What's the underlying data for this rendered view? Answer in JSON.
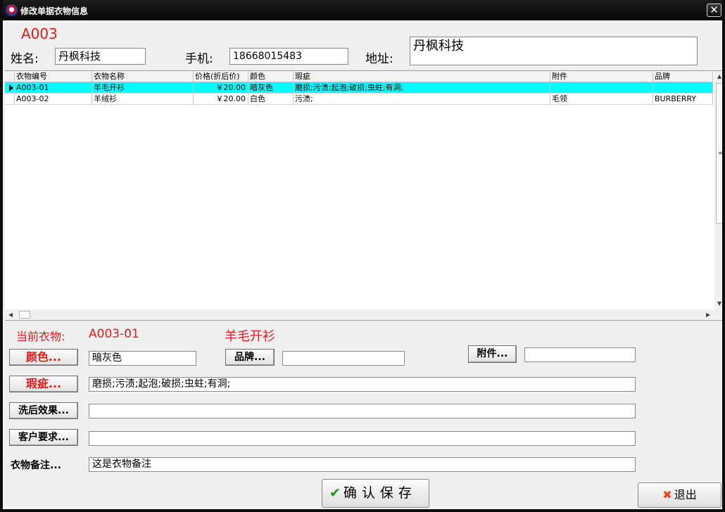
{
  "window": {
    "title": "修改单据衣物信息",
    "close_symbol": "✕"
  },
  "order": {
    "id": "A003",
    "name_label": "姓名:",
    "name_value": "丹枫科技",
    "phone_label": "手机:",
    "phone_value": "18668015483",
    "address_label": "地址:",
    "address_value": "丹枫科技"
  },
  "grid": {
    "columns": [
      "衣物编号",
      "衣物名称",
      "价格(折后价)",
      "颜色",
      "瑕疵",
      "附件",
      "品牌"
    ],
    "rows": [
      {
        "id": "A003-01",
        "name": "羊毛开衫",
        "price": "￥20.00",
        "color": "暗灰色",
        "defects": "磨损;污渍;起泡;破损;虫蛀;有洞;",
        "attachment": "",
        "brand": ""
      },
      {
        "id": "A003-02",
        "name": "羊绒衫",
        "price": "￥20.00",
        "color": "白色",
        "defects": "污渍;",
        "attachment": "毛领",
        "brand": "BURBERRY"
      }
    ],
    "selected_row": 0
  },
  "current": {
    "label": "当前衣物:",
    "id": "A003-01",
    "name": "羊毛开衫"
  },
  "form": {
    "color_button": "颜色...",
    "color_value": "暗灰色",
    "brand_button": "品牌...",
    "brand_value": "",
    "attachment_button": "附件...",
    "attachment_value": "",
    "defects_button": "瑕疵...",
    "defects_value": "磨损;污渍;起泡;破损;虫蛀;有洞;",
    "wash_effect_button": "洗后效果...",
    "wash_effect_value": "",
    "customer_request_button": "客户要求...",
    "customer_request_value": "",
    "notes_label": "衣物备注...",
    "notes_value": "这是衣物备注"
  },
  "actions": {
    "save_icon": "✔",
    "save_label": "确认保存",
    "exit_icon": "✖",
    "exit_label": "退出"
  },
  "icons": {
    "window_icon": "app-logo-icon",
    "close": "close-icon",
    "row_marker": "row-pointer-icon",
    "save": "checkmark-icon",
    "exit": "x-icon"
  },
  "colors": {
    "accent_red": "#e21b1b",
    "selected_row": "#00ffff",
    "titlebar": "#0c0c0c",
    "check_green": "#1b9a1b"
  }
}
